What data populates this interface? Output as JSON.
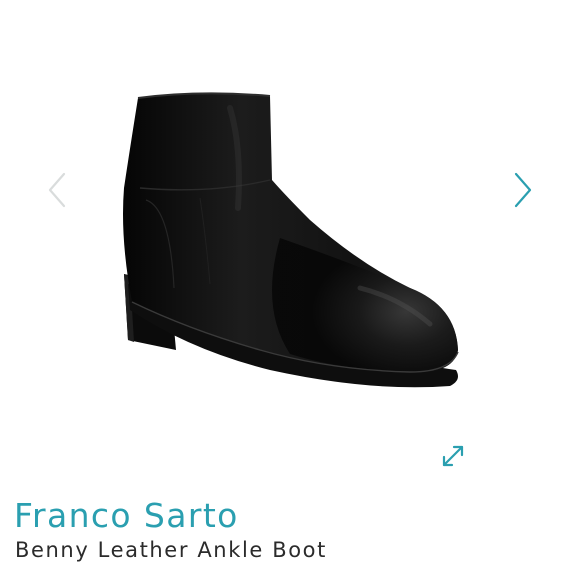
{
  "gallery": {
    "image_alt": "Black leather ankle boot",
    "prev_icon": "chevron-left-icon",
    "next_icon": "chevron-right-icon",
    "expand_icon": "expand-icon",
    "accent_color": "#2a9fb0",
    "prev_color": "#d9dcdc"
  },
  "product": {
    "brand": "Franco Sarto",
    "name": "Benny Leather Ankle Boot"
  }
}
